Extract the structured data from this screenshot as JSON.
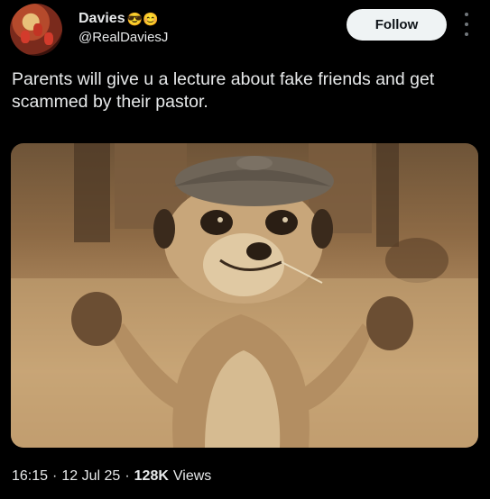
{
  "author": {
    "name": "Davies",
    "emojis": "😎😊",
    "handle": "@RealDaviesJ"
  },
  "follow_label": "Follow",
  "tweet": {
    "text": "Parents will give u a lecture about fake friends and get scammed by their pastor."
  },
  "meta": {
    "time": "16:15",
    "date": "12 Jul 25",
    "views_count": "128K",
    "views_label": "Views"
  },
  "colors": {
    "background": "#000000",
    "text": "#e7e9ea",
    "follow_bg": "#eff3f4",
    "follow_text": "#0f1419"
  }
}
